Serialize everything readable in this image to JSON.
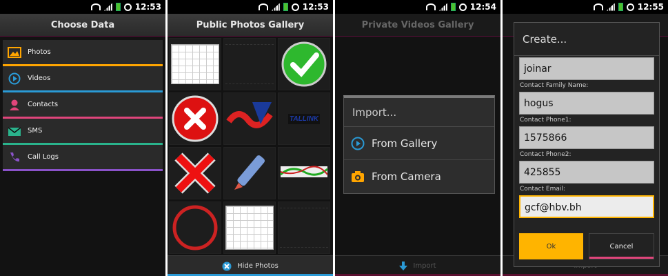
{
  "colors": {
    "photos": "#ffa500",
    "videos": "#2a9ad6",
    "contacts": "#e0457b",
    "sms": "#2ab38c",
    "calllogs": "#8a52c9",
    "accent_blue": "#2a9ad6",
    "button_ok": "#ffb400"
  },
  "screen1": {
    "time": "12:53",
    "title": "Choose Data",
    "items": [
      {
        "label": "Photos",
        "icon": "photo-icon"
      },
      {
        "label": "Videos",
        "icon": "play-icon"
      },
      {
        "label": "Contacts",
        "icon": "person-icon"
      },
      {
        "label": "SMS",
        "icon": "envelope-icon"
      },
      {
        "label": "Call Logs",
        "icon": "phone-icon"
      }
    ]
  },
  "screen2": {
    "time": "12:53",
    "title": "Public Photos Gallery",
    "logo_text": "TALLINK",
    "hide_label": "Hide Photos"
  },
  "screen3": {
    "time": "12:54",
    "title": "Private Videos Gallery",
    "dialog_title": "Import...",
    "option_gallery": "From Gallery",
    "option_camera": "From Camera",
    "import_label": "Import"
  },
  "screen4": {
    "time": "12:55",
    "dialog_title": "Create...",
    "first_name": "joinar",
    "family_label": "Contact Family Name:",
    "family_value": "hogus",
    "phone1_label": "Contact Phone1:",
    "phone1_value": "1575866",
    "phone2_label": "Contact Phone2:",
    "phone2_value": "425855",
    "email_label": "Contact Email:",
    "email_value": "gcf@hbv.bh",
    "ok_label": "Ok",
    "cancel_label": "Cancel",
    "import_label": "Import"
  }
}
